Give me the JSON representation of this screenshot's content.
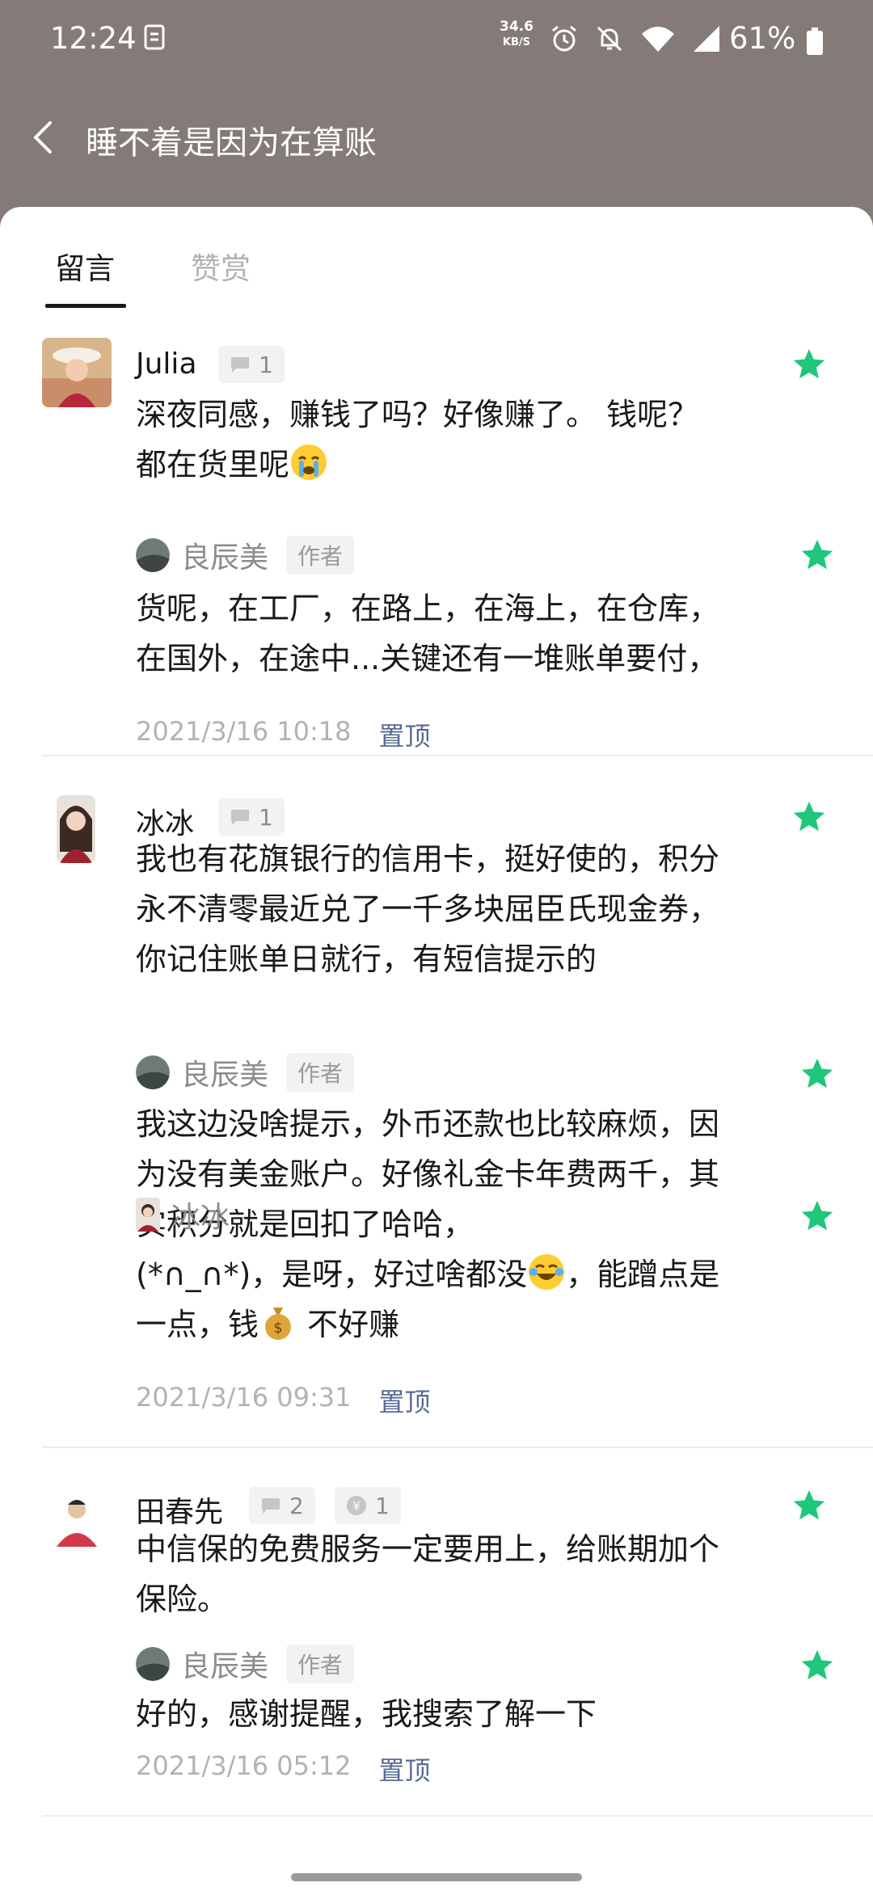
{
  "status_bar": {
    "time": "12:24",
    "net_speed_value": "34.6",
    "net_speed_unit": "KB/S",
    "battery": "61%",
    "icons": [
      "doc-icon",
      "alarm-icon",
      "mute-icon",
      "wifi-icon",
      "signal-icon",
      "battery-icon"
    ]
  },
  "header": {
    "title": "睡不着是因为在算账"
  },
  "tabs": [
    {
      "label": "留言"
    },
    {
      "label": "赞赏"
    }
  ],
  "accent_color": "#1ec77a",
  "link_color": "#576b95",
  "comments": [
    {
      "name": "Julia",
      "reply_count": "1",
      "text": " 深夜同感，赚钱了吗？好像赚了。  钱呢？ 都在货里呢",
      "emoji": "crying-face-emoji",
      "reply": {
        "name": "良辰美",
        "tag": "作者",
        "text": "货呢，在工厂，在路上，在海上，在仓库，在国外，在途中...关键还有一堆账单要付，"
      },
      "time": "2021/3/16 10:18",
      "pin": "置顶"
    },
    {
      "name": "冰冰",
      "reply_count": "1",
      "text": "我也有花旗银行的信用卡，挺好使的，积分永不清零最近兑了一千多块屈臣氏现金券，你记住账单日就行，有短信提示的",
      "reply": {
        "name": "良辰美",
        "tag": "作者",
        "text": "我这边没啥提示，外币还款也比较麻烦，因为没有美金账户。好像礼金卡年费两千，其实积分就是回扣了哈哈，"
      },
      "reply2": {
        "name": "冰冰",
        "text_a": "(*∩_∩*)，是呀，好过啥都没",
        "text_b": "，能蹭点是一点，钱",
        "text_c": " 不好赚"
      },
      "time": "2021/3/16 09:31",
      "pin": "置顶"
    },
    {
      "name": "田春先",
      "reply_count": "2",
      "reward_count": "1",
      "text": "中信保的免费服务一定要用上，给账期加个保险。",
      "reply": {
        "name": "良辰美",
        "tag": "作者",
        "text": "好的，感谢提醒，我搜索了解一下"
      },
      "time": "2021/3/16 05:12",
      "pin": "置顶"
    }
  ]
}
